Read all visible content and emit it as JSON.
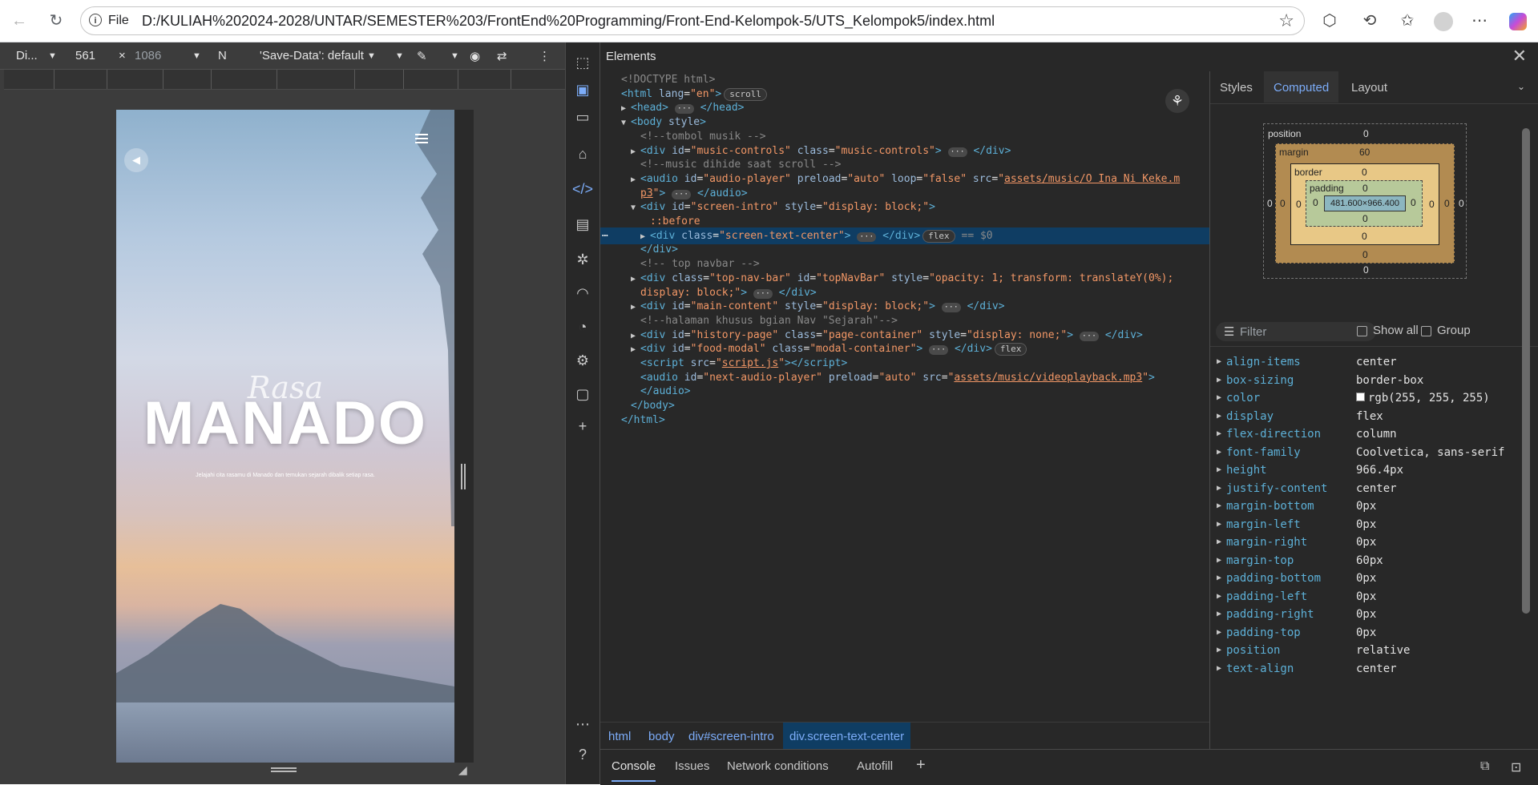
{
  "browser": {
    "file_label": "File",
    "url": "D:/KULIAH%202024-2028/UNTAR/SEMESTER%203/FrontEnd%20Programming/Front-End-Kelompok-5/UTS_Kelompok5/index.html",
    "icons": [
      "back-icon",
      "reload-icon",
      "info-icon",
      "star-icon",
      "extensions-icon",
      "tab-sync-icon",
      "favorites-icon",
      "profile-icon",
      "more-icon",
      "copilot-icon"
    ]
  },
  "device_toolbar": {
    "dimensions_label": "Di...",
    "width": "561",
    "times": "×",
    "height": "1086",
    "throttle": "N",
    "save_data": "'Save-Data': default"
  },
  "preview": {
    "script_title": "Rasa",
    "main_title": "MANADO",
    "tagline": "Jelajahi cita rasamu di Manado dan temukan sejarah dibalik setiap rasa."
  },
  "devtools": {
    "panel_title": "Elements",
    "dom_lines": [
      {
        "indent": 0,
        "tri": "",
        "html": "<span class='t-com'>&lt;!DOCTYPE html&gt;</span>"
      },
      {
        "indent": 0,
        "tri": "",
        "html": "<span class='t-tag'>&lt;html</span> <span class='t-attr'>lang</span>=<span class='t-val'>\"en\"</span><span class='t-tag'>&gt;</span><span class='pill'>scroll</span>"
      },
      {
        "indent": 1,
        "tri": "▶",
        "html": "<span class='t-tag'>&lt;head&gt;</span> <span class='ell'>···</span> <span class='t-tag'>&lt;/head&gt;</span>"
      },
      {
        "indent": 1,
        "tri": "▼",
        "html": "<span class='t-tag'>&lt;body</span> <span class='t-attr'>style</span><span class='t-tag'>&gt;</span>"
      },
      {
        "indent": 2,
        "tri": "",
        "html": "<span class='t-com'>&lt;!--tombol musik --&gt;</span>"
      },
      {
        "indent": 2,
        "tri": "▶",
        "html": "<span class='t-tag'>&lt;div</span> <span class='t-attr'>id</span>=<span class='t-val'>\"music-controls\"</span> <span class='t-attr'>class</span>=<span class='t-val'>\"music-controls\"</span><span class='t-tag'>&gt;</span> <span class='ell'>···</span> <span class='t-tag'>&lt;/div&gt;</span>"
      },
      {
        "indent": 2,
        "tri": "",
        "html": "<span class='t-com'>&lt;!--music dihide saat scroll --&gt;</span>"
      },
      {
        "indent": 2,
        "tri": "▶",
        "html": "<span class='t-tag'>&lt;audio</span> <span class='t-attr'>id</span>=<span class='t-val'>\"audio-player\"</span> <span class='t-attr'>preload</span>=<span class='t-val'>\"auto\"</span> <span class='t-attr'>loop</span>=<span class='t-val'>\"false\"</span> <span class='t-attr'>src</span>=<span class='t-val'>\"</span><span class='t-link'>assets/music/O Ina Ni Keke.m</span>"
      },
      {
        "indent": 2,
        "tri": "",
        "html": "<span class='t-link'>p3</span><span class='t-val'>\"</span><span class='t-tag'>&gt;</span> <span class='ell'>···</span> <span class='t-tag'>&lt;/audio&gt;</span>"
      },
      {
        "indent": 2,
        "tri": "▼",
        "html": "<span class='t-tag'>&lt;div</span> <span class='t-attr'>id</span>=<span class='t-val'>\"screen-intro\"</span> <span class='t-attr'>style</span>=<span class='t-val'>\"display: block;\"</span><span class='t-tag'>&gt;</span>"
      },
      {
        "indent": 3,
        "tri": "",
        "html": "<span class='t-val'>::before</span>"
      },
      {
        "indent": 3,
        "tri": "▶",
        "sel": true,
        "html": "<span class='t-tag'>&lt;div</span> <span class='t-attr'>class</span>=<span class='t-val'>\"screen-text-center\"</span><span class='t-tag'>&gt;</span> <span class='ell'>···</span> <span class='t-tag'>&lt;/div&gt;</span><span class='pill'>flex</span> <span class='t-com'>== $0</span>"
      },
      {
        "indent": 2,
        "tri": "",
        "html": "<span class='t-tag'>&lt;/div&gt;</span>"
      },
      {
        "indent": 2,
        "tri": "",
        "html": "<span class='t-com'>&lt;!-- top navbar --&gt;</span>"
      },
      {
        "indent": 2,
        "tri": "▶",
        "html": "<span class='t-tag'>&lt;div</span> <span class='t-attr'>class</span>=<span class='t-val'>\"top-nav-bar\"</span> <span class='t-attr'>id</span>=<span class='t-val'>\"topNavBar\"</span> <span class='t-attr'>style</span>=<span class='t-val'>\"opacity: 1; transform: translateY(0%);</span>"
      },
      {
        "indent": 2,
        "tri": "",
        "html": "<span class='t-val'>display: block;\"</span><span class='t-tag'>&gt;</span> <span class='ell'>···</span> <span class='t-tag'>&lt;/div&gt;</span>"
      },
      {
        "indent": 2,
        "tri": "▶",
        "html": "<span class='t-tag'>&lt;div</span> <span class='t-attr'>id</span>=<span class='t-val'>\"main-content\"</span> <span class='t-attr'>style</span>=<span class='t-val'>\"display: block;\"</span><span class='t-tag'>&gt;</span> <span class='ell'>···</span> <span class='t-tag'>&lt;/div&gt;</span>"
      },
      {
        "indent": 2,
        "tri": "",
        "html": "<span class='t-com'>&lt;!--halaman khusus bgian Nav \"Sejarah\"--&gt;</span>"
      },
      {
        "indent": 2,
        "tri": "▶",
        "html": "<span class='t-tag'>&lt;div</span> <span class='t-attr'>id</span>=<span class='t-val'>\"history-page\"</span> <span class='t-attr'>class</span>=<span class='t-val'>\"page-container\"</span> <span class='t-attr'>style</span>=<span class='t-val'>\"display: none;\"</span><span class='t-tag'>&gt;</span> <span class='ell'>···</span> <span class='t-tag'>&lt;/div&gt;</span>"
      },
      {
        "indent": 2,
        "tri": "▶",
        "html": "<span class='t-tag'>&lt;div</span> <span class='t-attr'>id</span>=<span class='t-val'>\"food-modal\"</span> <span class='t-attr'>class</span>=<span class='t-val'>\"modal-container\"</span><span class='t-tag'>&gt;</span> <span class='ell'>···</span> <span class='t-tag'>&lt;/div&gt;</span><span class='pill'>flex</span>"
      },
      {
        "indent": 2,
        "tri": "",
        "html": "<span class='t-tag'>&lt;script</span> <span class='t-attr'>src</span>=<span class='t-val'>\"</span><span class='t-link'>script.js</span><span class='t-val'>\"</span><span class='t-tag'>&gt;&lt;/script&gt;</span>"
      },
      {
        "indent": 2,
        "tri": "",
        "html": "<span class='t-tag'>&lt;audio</span> <span class='t-attr'>id</span>=<span class='t-val'>\"next-audio-player\"</span> <span class='t-attr'>preload</span>=<span class='t-val'>\"auto\"</span> <span class='t-attr'>src</span>=<span class='t-val'>\"</span><span class='t-link'>assets/music/videoplayback.mp3</span><span class='t-val'>\"</span><span class='t-tag'>&gt;</span>"
      },
      {
        "indent": 2,
        "tri": "",
        "html": "<span class='t-tag'>&lt;/audio&gt;</span>"
      },
      {
        "indent": 1,
        "tri": "",
        "html": "<span class='t-tag'>&lt;/body&gt;</span>"
      },
      {
        "indent": 0,
        "tri": "",
        "html": "<span class='t-tag'>&lt;/html&gt;</span>"
      }
    ],
    "breadcrumbs": [
      "html",
      "body",
      "div#screen-intro",
      "div.screen-text-center"
    ],
    "drawer_tabs": [
      "Console",
      "Issues",
      "Network conditions",
      "Autofill"
    ],
    "styles_tabs": [
      "Styles",
      "Computed",
      "Layout"
    ],
    "box_model": {
      "position_label": "position",
      "position_top": "0",
      "position_bottom": "0",
      "position_left": "0",
      "position_right": "0",
      "margin_label": "margin",
      "margin_top": "60",
      "margin_bottom": "0",
      "margin_left": "0",
      "margin_right": "0",
      "border_label": "border",
      "border_top": "0",
      "border_bottom": "0",
      "border_left": "0",
      "border_right": "0",
      "padding_label": "padding",
      "padding_top": "0",
      "padding_bottom": "0",
      "padding_left": "0",
      "padding_right": "0",
      "content": "481.600×966.400"
    },
    "filter_placeholder": "Filter",
    "show_all": "Show all",
    "group": "Group",
    "computed": [
      {
        "name": "align-items",
        "value": "center"
      },
      {
        "name": "box-sizing",
        "value": "border-box"
      },
      {
        "name": "color",
        "value": "rgb(255, 255, 255)"
      },
      {
        "name": "display",
        "value": "flex"
      },
      {
        "name": "flex-direction",
        "value": "column"
      },
      {
        "name": "font-family",
        "value": "Coolvetica, sans-serif"
      },
      {
        "name": "height",
        "value": "966.4px"
      },
      {
        "name": "justify-content",
        "value": "center"
      },
      {
        "name": "margin-bottom",
        "value": "0px"
      },
      {
        "name": "margin-left",
        "value": "0px"
      },
      {
        "name": "margin-right",
        "value": "0px"
      },
      {
        "name": "margin-top",
        "value": "60px"
      },
      {
        "name": "padding-bottom",
        "value": "0px"
      },
      {
        "name": "padding-left",
        "value": "0px"
      },
      {
        "name": "padding-right",
        "value": "0px"
      },
      {
        "name": "padding-top",
        "value": "0px"
      },
      {
        "name": "position",
        "value": "relative"
      },
      {
        "name": "text-align",
        "value": "center"
      }
    ]
  }
}
